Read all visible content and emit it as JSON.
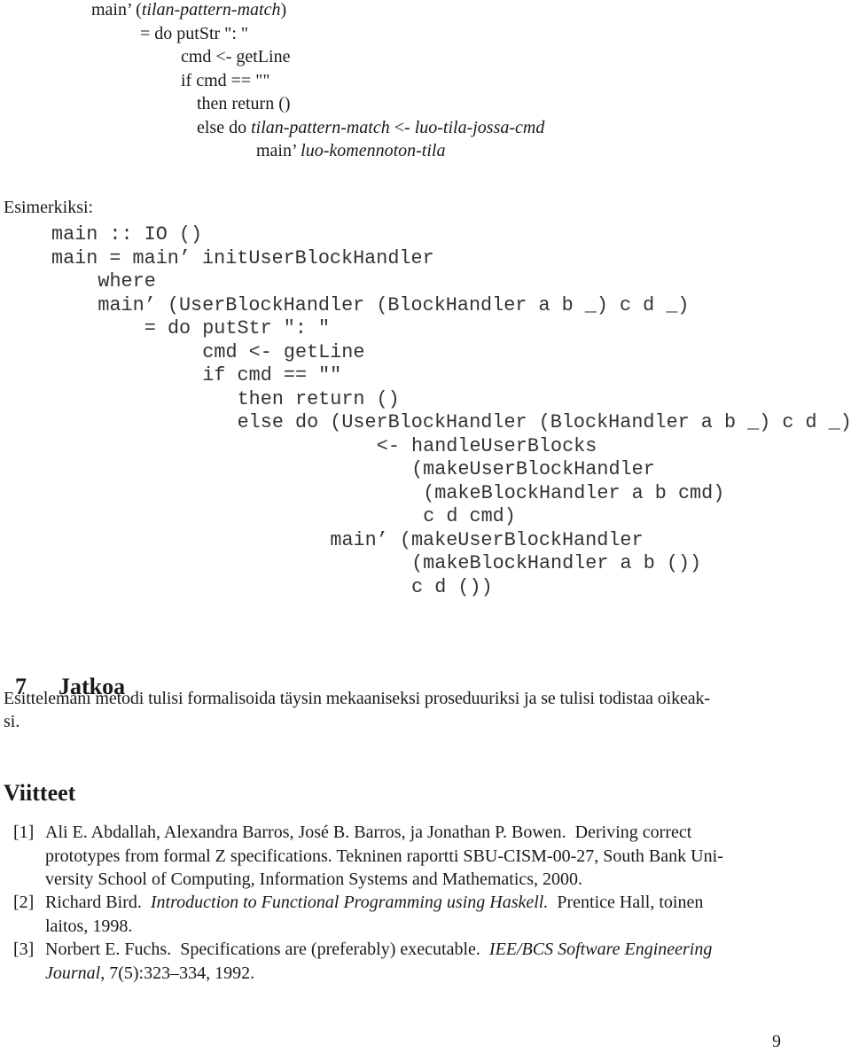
{
  "pseudocode": {
    "lines": [
      {
        "indent": 103,
        "parts": [
          {
            "t": "main’ (",
            "i": false
          },
          {
            "t": "tilan-pattern-match",
            "i": true
          },
          {
            "t": ")",
            "i": false
          }
        ]
      },
      {
        "indent": 158,
        "parts": [
          {
            "t": "= do putStr \": \"",
            "i": false
          }
        ]
      },
      {
        "indent": 204,
        "parts": [
          {
            "t": "cmd <- getLine",
            "i": false
          }
        ]
      },
      {
        "indent": 204,
        "parts": [
          {
            "t": "if cmd == \"\"",
            "i": false
          }
        ]
      },
      {
        "indent": 222,
        "parts": [
          {
            "t": "then return ()",
            "i": false
          }
        ]
      },
      {
        "indent": 222,
        "parts": [
          {
            "t": "else do ",
            "i": false
          },
          {
            "t": "tilan-pattern-match",
            "i": true
          },
          {
            "t": " <- ",
            "i": false
          },
          {
            "t": "luo-tila-jossa-cmd",
            "i": true
          }
        ]
      },
      {
        "indent": 289,
        "parts": [
          {
            "t": "main’ ",
            "i": false
          },
          {
            "t": "luo-komennoton-tila",
            "i": true
          }
        ]
      }
    ]
  },
  "examples_label": "Esimerkiksi:",
  "code": {
    "lines": [
      {
        "col": 0,
        "text": "main :: IO ()"
      },
      {
        "col": 0,
        "text": "main = main’ initUserBlockHandler"
      },
      {
        "col": 4,
        "text": "where"
      },
      {
        "col": 4,
        "text": "main’ (UserBlockHandler (BlockHandler a b _) c d _)"
      },
      {
        "col": 8,
        "text": "= do putStr \": \""
      },
      {
        "col": 13,
        "text": "cmd <- getLine"
      },
      {
        "col": 13,
        "text": "if cmd == \"\""
      },
      {
        "col": 16,
        "text": "then return ()"
      },
      {
        "col": 16,
        "text": "else do (UserBlockHandler (BlockHandler a b _) c d _)"
      },
      {
        "col": 28,
        "text": "<- handleUserBlocks"
      },
      {
        "col": 31,
        "text": "(makeUserBlockHandler"
      },
      {
        "col": 32,
        "text": "(makeBlockHandler a b cmd)"
      },
      {
        "col": 32,
        "text": "c d cmd)"
      },
      {
        "col": 24,
        "text": "main’ (makeUserBlockHandler"
      },
      {
        "col": 31,
        "text": "(makeBlockHandler a b ())"
      },
      {
        "col": 31,
        "text": "c d ())"
      }
    ]
  },
  "section7": {
    "number": "7",
    "title": "Jatkoa",
    "paragraph_line1": "Esittelemäni metodi tulisi formalisoida täysin mekaaniseksi proseduuriksi ja se tulisi todistaa oikeak-",
    "paragraph_line2": "si."
  },
  "references": {
    "title": "Viitteet",
    "items": [
      {
        "num": "[1]",
        "lines": [
          [
            {
              "t": "Ali E. Abdallah, Alexandra Barros, José B. Barros, ja Jonathan P. Bowen.  Deriving correct",
              "i": false
            }
          ],
          [
            {
              "t": "prototypes from formal Z specifications. Tekninen raportti SBU-CISM-00-27, South Bank Uni-",
              "i": false
            }
          ],
          [
            {
              "t": "versity School of Computing, Information Systems and Mathematics, 2000.",
              "i": false
            }
          ]
        ]
      },
      {
        "num": "[2]",
        "lines": [
          [
            {
              "t": "Richard Bird.  ",
              "i": false
            },
            {
              "t": "Introduction to Functional Programming using Haskell.",
              "i": true
            },
            {
              "t": "  Prentice Hall, toinen",
              "i": false
            }
          ],
          [
            {
              "t": "laitos, 1998.",
              "i": false
            }
          ]
        ]
      },
      {
        "num": "[3]",
        "lines": [
          [
            {
              "t": "Norbert E. Fuchs.  Specifications are (preferably) executable.  ",
              "i": false
            },
            {
              "t": "IEE/BCS Software Engineering",
              "i": true
            }
          ],
          [
            {
              "t": "Journal",
              "i": true
            },
            {
              "t": ", 7(5):323–334, 1992.",
              "i": false
            }
          ]
        ]
      }
    ]
  },
  "page_number": "9"
}
